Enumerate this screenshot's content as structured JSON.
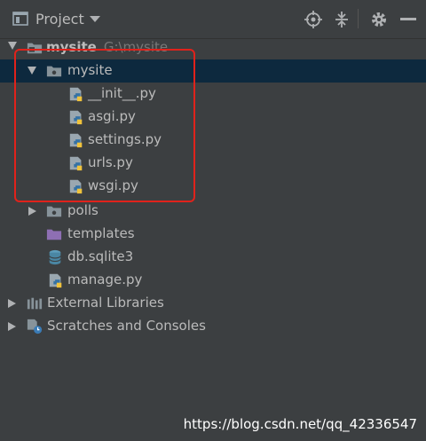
{
  "toolbar": {
    "title": "Project",
    "icons": [
      "project-view-icon",
      "dropdown-icon",
      "locate-icon",
      "collapse-all-icon",
      "gear-icon",
      "minimize-icon"
    ]
  },
  "tree": {
    "root": {
      "name": "mysite",
      "path": "G:\\mysite"
    },
    "mysite_pkg": "mysite",
    "files": [
      "__init__.py",
      "asgi.py",
      "settings.py",
      "urls.py",
      "wsgi.py"
    ],
    "polls": "polls",
    "templates": "templates",
    "db": "db.sqlite3",
    "manage": "manage.py",
    "external": "External Libraries",
    "scratches": "Scratches and Consoles"
  },
  "colors": {
    "background": "#3c3f41",
    "selection": "#0d293e",
    "annotation": "#e0221b"
  },
  "watermark": "https://blog.csdn.net/qq_42336547"
}
